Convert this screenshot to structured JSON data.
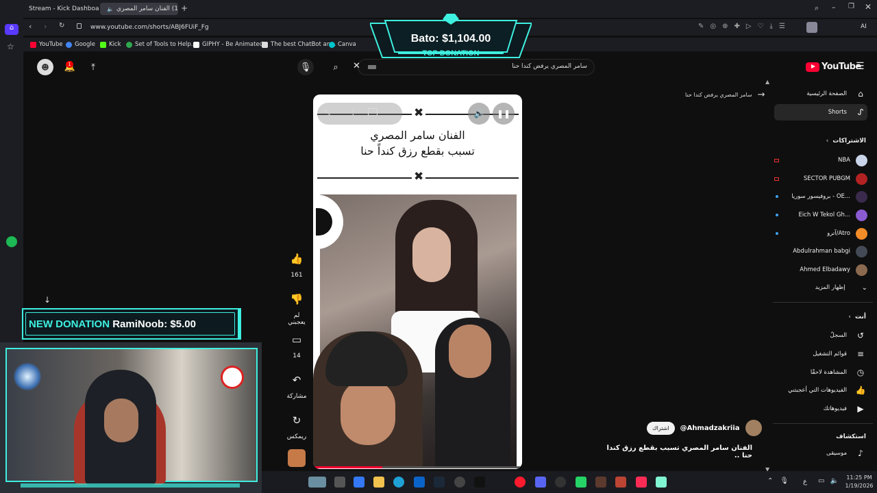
{
  "browser": {
    "tabs": [
      {
        "label": "Stream - Kick Dashboard",
        "active": false
      },
      {
        "label": "(1) الفنان سامر المصري",
        "active": true
      }
    ],
    "url": "www.youtube.com/shorts/ABJ6FUiF_Fg",
    "ai_label": "AI",
    "bookmarks": [
      "YouTube",
      "Google",
      "Kick",
      "Set of Tools to Help...",
      "GIPHY - Be Animated",
      "The best ChatBot an...",
      "Canva"
    ]
  },
  "youtube": {
    "logo": "YouTube",
    "search": {
      "value": "سامر المصري يرفض كندا حنا"
    },
    "notification_count": "1",
    "back_link": "سامر المصري يرفض كندا حنا",
    "nav": [
      {
        "label": "الصفحة الرئيسية",
        "icon": "home-icon"
      },
      {
        "label": "Shorts",
        "icon": "shorts-icon",
        "selected": true
      }
    ],
    "subscriptions_header": "الاشتراكات",
    "subscriptions": [
      {
        "label": "NBA",
        "color": "#c9d4ea",
        "indicator": "live"
      },
      {
        "label": "SECTOR PUBGM",
        "color": "#b22222",
        "indicator": "live"
      },
      {
        "label": "بروفيسور سوريا - OE...",
        "color": "#3a2b4d",
        "indicator": "dot"
      },
      {
        "label": "Eich W Tekol Gh...",
        "color": "#8a5bd1",
        "indicator": "dot"
      },
      {
        "label": "آترو/Atro",
        "color": "#f28c28",
        "indicator": "dot"
      },
      {
        "label": "Abdulrahman babgi",
        "color": "#444a55",
        "indicator": ""
      },
      {
        "label": "Ahmed Elbadawy",
        "color": "#8b6a50",
        "indicator": ""
      }
    ],
    "show_more": "إظهار المزيد",
    "you_header": "أنت",
    "you_items": [
      {
        "label": "السجلّ",
        "icon": "history-icon"
      },
      {
        "label": "قوائم التشغيل",
        "icon": "playlist-icon"
      },
      {
        "label": "المشاهدة لاحقًا",
        "icon": "watch-later-icon"
      },
      {
        "label": "الفيديوهات التي أعجبتني",
        "icon": "liked-icon"
      },
      {
        "label": "فيديوهاتك",
        "icon": "your-videos-icon"
      }
    ],
    "explore_header": "استكشاف",
    "explore_items": [
      {
        "label": "موسيقى",
        "icon": "music-icon"
      }
    ]
  },
  "short": {
    "title_line1": "الفنان سامر المصري",
    "title_line2": "تسبب بقطع رزق كنداً حنا",
    "channel": "@Ahmadzakriia",
    "subscribe": "اشتراك",
    "caption": "الفنان سامر المصري تسبب بقطع رزق كندا حنا ..",
    "actions": [
      {
        "label": "161",
        "icon": "like-icon"
      },
      {
        "label": "لم يعجبني",
        "icon": "dislike-icon"
      },
      {
        "label": "14",
        "icon": "comment-icon"
      },
      {
        "label": "مشاركة",
        "icon": "share-icon"
      },
      {
        "label": "ريمكس",
        "icon": "remix-icon"
      }
    ],
    "progress": 0.33
  },
  "overlays": {
    "top_donation": {
      "amount": "Bato: $1,104.00",
      "caption": "TOP DONATION"
    },
    "new_donation": {
      "label": "NEW DONATION",
      "text": "RamiNoob: $5.00"
    }
  },
  "taskbar": {
    "time": "11:25 PM",
    "date": "1/19/2026",
    "lang": "ع"
  },
  "colors": {
    "accent": "#ff0033",
    "overlay_cyan": "#3ef0e0",
    "spotify": "#1db954"
  }
}
